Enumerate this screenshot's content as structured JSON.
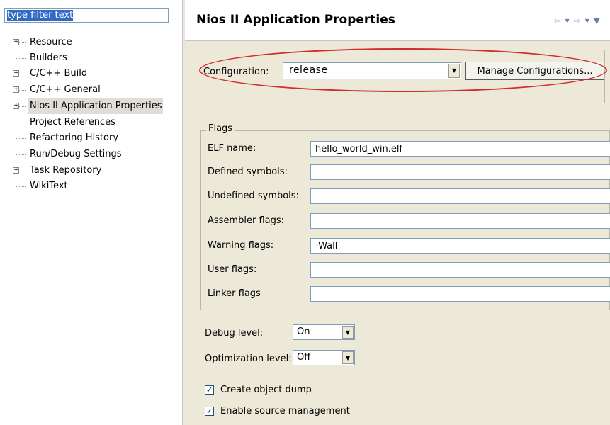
{
  "filter": {
    "text": "type filter text"
  },
  "tree": [
    {
      "label": "Resource",
      "expandable": true
    },
    {
      "label": "Builders",
      "expandable": false
    },
    {
      "label": "C/C++ Build",
      "expandable": true
    },
    {
      "label": "C/C++ General",
      "expandable": true
    },
    {
      "label": "Nios II Application Properties",
      "expandable": true,
      "selected": true
    },
    {
      "label": "Project References",
      "expandable": false
    },
    {
      "label": "Refactoring History",
      "expandable": false
    },
    {
      "label": "Run/Debug Settings",
      "expandable": false
    },
    {
      "label": "Task Repository",
      "expandable": true
    },
    {
      "label": "WikiText",
      "expandable": false
    }
  ],
  "header": {
    "title": "Nios II Application Properties",
    "nav_icons": [
      "back-arrow-icon",
      "dropdown-icon",
      "forward-arrow-icon",
      "dropdown-icon",
      "menu-icon"
    ]
  },
  "configuration": {
    "label": "Configuration:",
    "value": "release",
    "manage_button": "Manage Configurations..."
  },
  "flags": {
    "legend": "Flags",
    "rows": [
      {
        "label": "ELF name:",
        "value": "hello_world_win.elf"
      },
      {
        "label": "Defined symbols:",
        "value": ""
      },
      {
        "label": "Undefined symbols:",
        "value": ""
      },
      {
        "label": "Assembler flags:",
        "value": ""
      },
      {
        "label": "Warning flags:",
        "value": "-Wall"
      },
      {
        "label": "User flags:",
        "value": ""
      },
      {
        "label": "Linker flags",
        "value": ""
      }
    ]
  },
  "debug": {
    "label": "Debug level:",
    "value": "On"
  },
  "optimization": {
    "label": "Optimization level:",
    "value": "Off"
  },
  "checkboxes": [
    {
      "label": "Create object dump",
      "checked": true
    },
    {
      "label": "Enable source management",
      "checked": true
    }
  ],
  "colors": {
    "highlight": "#316ac5",
    "annotation": "#d12b2b",
    "panel": "#ece9d8"
  }
}
